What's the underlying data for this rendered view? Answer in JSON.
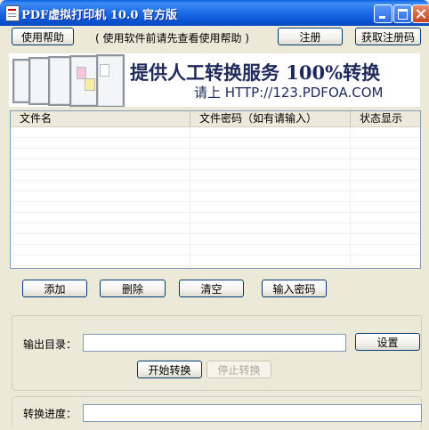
{
  "window": {
    "title": "PDF虚拟打印机 10.0 官方版"
  },
  "toolbar": {
    "help_label": "使用帮助",
    "hint_text": "( 使用软件前请先查看使用帮助 )",
    "register_label": "注册",
    "get_code_label": "获取注册码"
  },
  "banner": {
    "title": "提供人工转换服务 100%转换",
    "subtitle": "请上 HTTP://123.PDFOA.COM"
  },
  "file_table": {
    "columns": [
      "文件名",
      "文件密码（如有请输入）",
      "状态显示"
    ],
    "rows": []
  },
  "actions": {
    "add_label": "添加",
    "delete_label": "删除",
    "clear_label": "清空",
    "password_label": "输入密码"
  },
  "output": {
    "dir_label": "输出目录：",
    "dir_value": "",
    "settings_label": "设置",
    "start_label": "开始转换",
    "stop_label": "停止转换"
  },
  "progress": {
    "label": "转换进度：",
    "value": 0
  },
  "colors": {
    "titlebar": "#0B55D6",
    "dialog_bg": "#ECE9D8",
    "banner_text": "#1F2A5C",
    "button_border": "#003C74",
    "disabled_text": "#ACA899"
  }
}
